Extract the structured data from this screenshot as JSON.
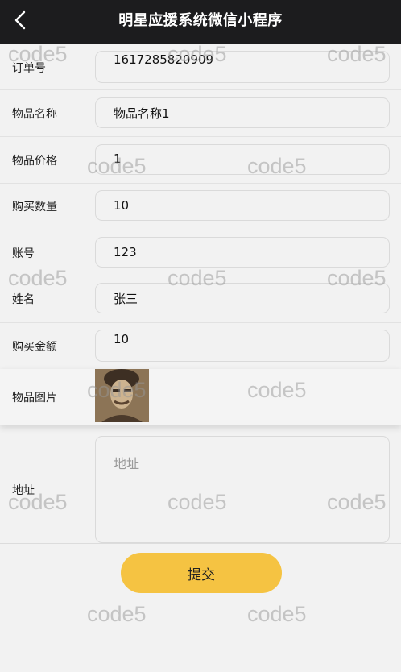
{
  "navbar": {
    "back_icon": "chevron-left-icon",
    "title": "明星应援系统微信小程序"
  },
  "form": {
    "order_no": {
      "label": "订单号",
      "value": "1617285820909"
    },
    "item_name": {
      "label": "物品名称",
      "value": "物品名称1"
    },
    "item_price": {
      "label": "物品价格",
      "value": "1"
    },
    "quantity": {
      "label": "购买数量",
      "value": "10"
    },
    "account": {
      "label": "账号",
      "value": "123"
    },
    "name": {
      "label": "姓名",
      "value": "张三"
    },
    "total": {
      "label": "购买金额",
      "value": "10"
    },
    "image": {
      "label": "物品图片"
    },
    "address": {
      "label": "地址",
      "placeholder": "地址",
      "value": ""
    }
  },
  "submit_label": "提交",
  "watermark": "code5",
  "colors": {
    "navbar": "#1c1c1e",
    "submit": "#f5c342",
    "background": "#f2f2f2"
  }
}
